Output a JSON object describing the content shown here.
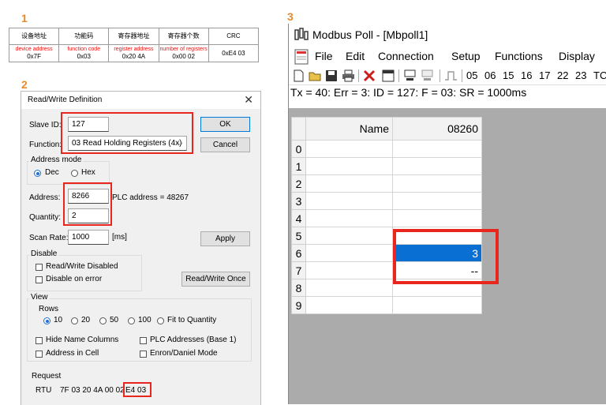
{
  "steps": {
    "one": "1",
    "two": "2",
    "three": "3"
  },
  "frame_table": {
    "headers": [
      "设备地址",
      "功能码",
      "寄存器地址",
      "寄存器个数",
      "CRC"
    ],
    "labels_en": [
      "device address",
      "function code",
      "register address",
      "number of registers",
      ""
    ],
    "values": [
      "0x7F",
      "0x03",
      "0x20 4A",
      "0x00 02",
      "0xE4 03"
    ]
  },
  "dialog": {
    "title": "Read/Write Definition",
    "close_glyph": "✕",
    "slave_id_label": "Slave ID:",
    "slave_id_value": "127",
    "function_label": "Function:",
    "function_value": "03 Read Holding Registers (4x)",
    "combo_arrow": "⌵",
    "ok_label": "OK",
    "cancel_label": "Cancel",
    "address_mode_label": "Address mode",
    "dec_label": "Dec",
    "hex_label": "Hex",
    "address_label": "Address:",
    "address_value": "8266",
    "plc_address_text": "PLC address = 48267",
    "quantity_label": "Quantity:",
    "quantity_value": "2",
    "scan_rate_label": "Scan Rate:",
    "scan_rate_value": "1000",
    "scan_rate_unit": "[ms]",
    "apply_label": "Apply",
    "disable_label": "Disable",
    "rw_disabled_label": "Read/Write Disabled",
    "disable_on_error_label": "Disable on error",
    "rw_once_label": "Read/Write Once",
    "view_label": "View",
    "rows_label": "Rows",
    "rows_options": [
      "10",
      "20",
      "50",
      "100",
      "Fit to Quantity"
    ],
    "hide_name_columns_label": "Hide Name Columns",
    "plc_addresses_label": "PLC Addresses (Base 1)",
    "address_in_cell_label": "Address in Cell",
    "enron_label": "Enron/Daniel Mode",
    "request_label": "Request",
    "rtu_label": "RTU",
    "request_bytes": "7F 03 20 4A 00 02",
    "request_crc": "E4 03"
  },
  "mbpoll": {
    "title": "Modbus Poll - [Mbpoll1]",
    "menu": [
      "File",
      "Edit",
      "Connection",
      "Setup",
      "Functions",
      "Display"
    ],
    "function_codes": [
      "05",
      "06",
      "15",
      "16",
      "17",
      "22",
      "23",
      "TC"
    ],
    "status": "Tx = 40: Err = 3: ID = 127: F = 03: SR = 1000ms",
    "grid": {
      "name_header": "Name",
      "value_header": "08260",
      "rows": [
        {
          "index": "0",
          "name": "",
          "value": ""
        },
        {
          "index": "1",
          "name": "",
          "value": ""
        },
        {
          "index": "2",
          "name": "",
          "value": ""
        },
        {
          "index": "3",
          "name": "",
          "value": ""
        },
        {
          "index": "4",
          "name": "",
          "value": ""
        },
        {
          "index": "5",
          "name": "",
          "value": ""
        },
        {
          "index": "6",
          "name": "",
          "value": "3"
        },
        {
          "index": "7",
          "name": "",
          "value": "--"
        },
        {
          "index": "8",
          "name": "",
          "value": ""
        },
        {
          "index": "9",
          "name": "",
          "value": ""
        }
      ]
    },
    "colors": {
      "selection": "#0a6fd3",
      "highlight_box": "#e8261d"
    }
  }
}
